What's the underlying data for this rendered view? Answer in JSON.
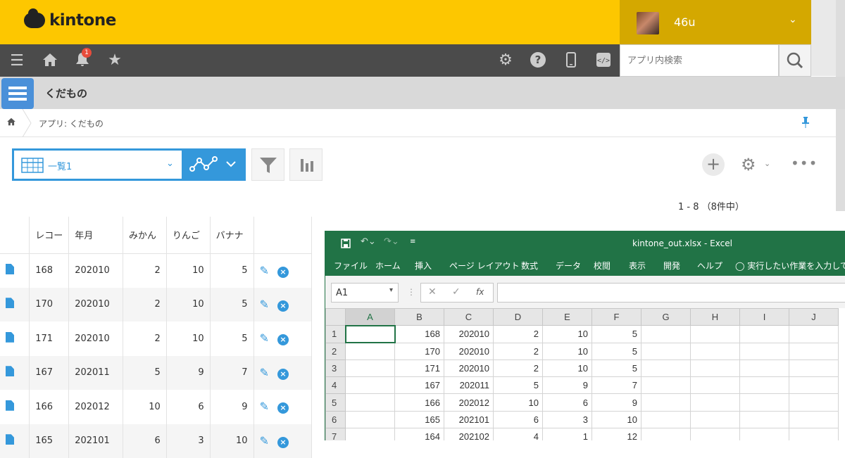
{
  "header": {
    "logo": "kintone",
    "username": "46u"
  },
  "toolbar": {
    "notification_count": "1",
    "search_placeholder": "アプリ内検索"
  },
  "app": {
    "title": "くだもの",
    "breadcrumb": "アプリ: くだもの"
  },
  "view": {
    "name": "一覧1",
    "pagination": "1 - 8 （8件中）"
  },
  "table": {
    "headers": [
      "レコー",
      "年月",
      "みかん",
      "りんご",
      "バナナ"
    ],
    "rows": [
      [
        "168",
        "202010",
        "2",
        "10",
        "5"
      ],
      [
        "170",
        "202010",
        "2",
        "10",
        "5"
      ],
      [
        "171",
        "202010",
        "2",
        "10",
        "5"
      ],
      [
        "167",
        "202011",
        "5",
        "9",
        "7"
      ],
      [
        "166",
        "202012",
        "10",
        "6",
        "9"
      ],
      [
        "165",
        "202101",
        "6",
        "3",
        "10"
      ]
    ]
  },
  "excel": {
    "title": "kintone_out.xlsx  -  Excel",
    "ribbon_tabs": [
      "ファイル",
      "ホーム",
      "挿入",
      "ページ レイアウト",
      "数式",
      "データ",
      "校閲",
      "表示",
      "開発",
      "ヘルプ"
    ],
    "tell_me": "実行したい作業を入力してくだ",
    "name_box": "A1",
    "columns": [
      "A",
      "B",
      "C",
      "D",
      "E",
      "F",
      "G",
      "H",
      "I",
      "J"
    ],
    "rows": [
      [
        "1",
        "",
        "168",
        "202010",
        "2",
        "10",
        "5"
      ],
      [
        "2",
        "",
        "170",
        "202010",
        "2",
        "10",
        "5"
      ],
      [
        "3",
        "",
        "171",
        "202010",
        "2",
        "10",
        "5"
      ],
      [
        "4",
        "",
        "167",
        "202011",
        "5",
        "9",
        "7"
      ],
      [
        "5",
        "",
        "166",
        "202012",
        "10",
        "6",
        "9"
      ],
      [
        "6",
        "",
        "165",
        "202101",
        "6",
        "3",
        "10"
      ],
      [
        "7",
        "",
        "164",
        "202102",
        "4",
        "1",
        "12"
      ]
    ]
  }
}
